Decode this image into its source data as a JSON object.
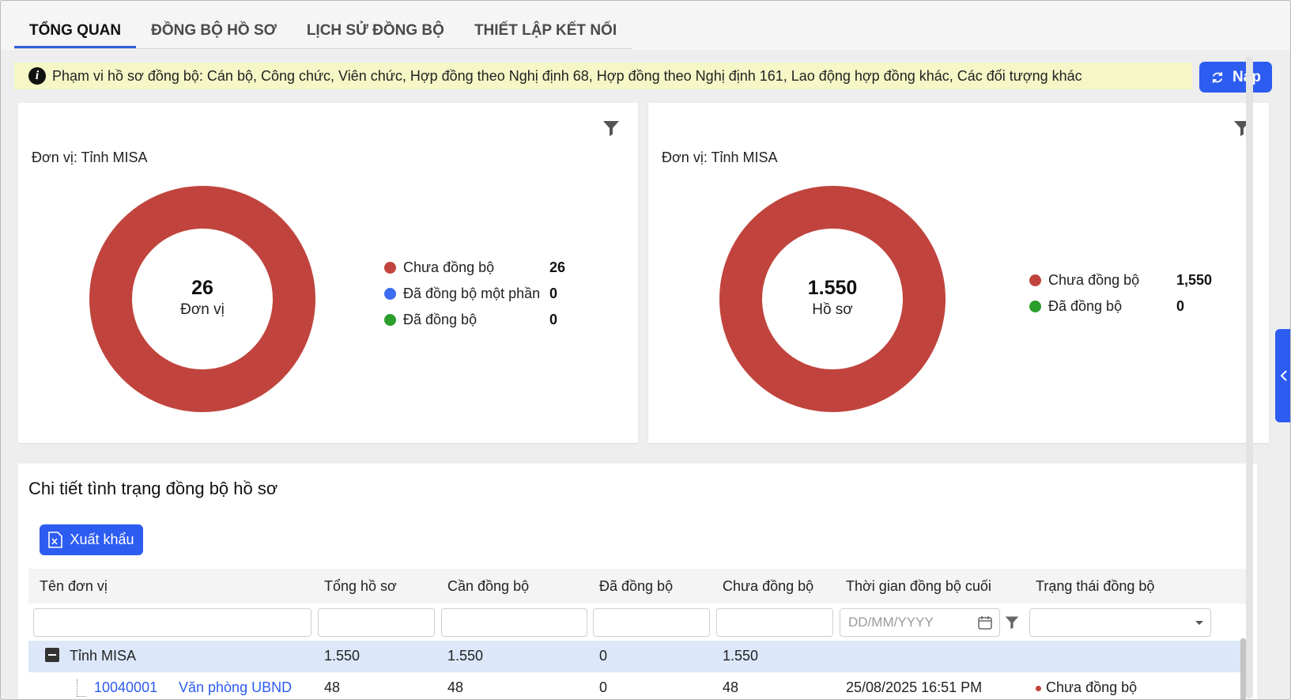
{
  "tabs": [
    {
      "label": "TỔNG QUAN",
      "active": true
    },
    {
      "label": "ĐỒNG BỘ HỒ SƠ"
    },
    {
      "label": "LỊCH SỬ ĐỒNG BỘ"
    },
    {
      "label": "THIẾT LẬP KẾT NỐI"
    }
  ],
  "notice": {
    "icon": "info-icon",
    "text": "Phạm vi hồ sơ đồng bộ: Cán bộ, Công chức, Viên chức, Hợp đồng theo Nghị định 68, Hợp đồng theo Nghị định 161, Lao động hợp đồng khác, Các đối tượng khác"
  },
  "refresh_button": {
    "label": "Nạp",
    "icon": "refresh-icon"
  },
  "cards": [
    {
      "unit_label": "Đơn vị:",
      "unit_name": "Tỉnh MISA",
      "total": "26",
      "total_label": "Đơn vị",
      "legend": [
        {
          "label": "Chưa đồng bộ",
          "value": "26",
          "color": "#c0443d"
        },
        {
          "label": "Đã đồng bộ một phần",
          "value": "0",
          "color": "#3d6cf0"
        },
        {
          "label": "Đã đồng bộ",
          "value": "0",
          "color": "#2a9d2a"
        }
      ]
    },
    {
      "unit_label": "Đơn vị:",
      "unit_name": "Tỉnh MISA",
      "total": "1.550",
      "total_label": "Hồ sơ",
      "legend": [
        {
          "label": "Chưa đồng bộ",
          "value": "1,550",
          "color": "#c0443d"
        },
        {
          "label": "Đã đồng bộ",
          "value": "0",
          "color": "#2a9d2a"
        }
      ]
    }
  ],
  "chart_data": [
    {
      "type": "pie",
      "categories": [
        "Chưa đồng bộ",
        "Đã đồng bộ một phần",
        "Đã đồng bộ"
      ],
      "values": [
        26,
        0,
        0
      ],
      "center_value": "26",
      "center_label": "Đơn vị"
    },
    {
      "type": "pie",
      "categories": [
        "Chưa đồng bộ",
        "Đã đồng bộ"
      ],
      "values": [
        1550,
        0
      ],
      "center_value": "1.550",
      "center_label": "Hồ sơ"
    }
  ],
  "detail": {
    "title": "Chi tiết tình trạng đồng bộ hồ sơ",
    "export_label": "Xuất khẩu",
    "columns": [
      "Tên đơn vị",
      "Tổng hồ sơ",
      "Cần đồng bộ",
      "Đã đồng bộ",
      "Chưa đồng bộ",
      "Thời gian đồng bộ cuối",
      "Trạng thái đồng bộ"
    ],
    "date_placeholder": "DD/MM/YYYY",
    "group_row": {
      "name": "Tỉnh MISA",
      "total": "1.550",
      "need": "1.550",
      "synced": "0",
      "unsynced": "1.550"
    },
    "child_row": {
      "code": "10040001",
      "name": "Văn phòng UBND",
      "total": "48",
      "need": "48",
      "synced": "0",
      "unsynced": "48",
      "last_sync": "25/08/2025 16:51 PM",
      "status": "Chưa đồng bộ"
    }
  }
}
